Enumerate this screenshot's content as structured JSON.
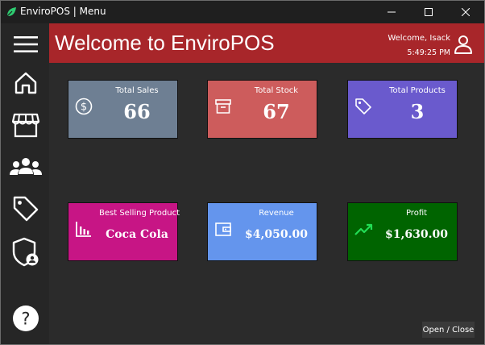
{
  "window": {
    "title": "EnviroPOS | Menu",
    "app_icon": "leaf-logo-icon",
    "controls": [
      "minimize-icon",
      "maximize-icon",
      "close-icon"
    ]
  },
  "sidebar": {
    "items": [
      {
        "name": "menu",
        "icon": "hamburger-icon"
      },
      {
        "name": "home",
        "icon": "home-icon"
      },
      {
        "name": "store",
        "icon": "store-icon"
      },
      {
        "name": "users",
        "icon": "users-group-icon"
      },
      {
        "name": "products",
        "icon": "tag-icon"
      },
      {
        "name": "admin",
        "icon": "shield-user-icon"
      },
      {
        "name": "help",
        "icon": "help-circle-icon",
        "label": "?"
      }
    ]
  },
  "header": {
    "title": "Welcome to EnviroPOS",
    "user_greeting": "Welcome, Isack",
    "time": "5:49:25 PM",
    "user_icon": "user-icon",
    "color": "#a8262a"
  },
  "cards": [
    {
      "label": "Total Sales",
      "value": "66",
      "icon": "dollar-circle-icon",
      "color": "#6e7f93"
    },
    {
      "label": "Total Stock",
      "value": "67",
      "icon": "archive-box-icon",
      "color": "#cd5c5c"
    },
    {
      "label": "Total Products",
      "value": "3",
      "icon": "tag-icon",
      "color": "#6a5acd"
    },
    {
      "label": "Best Selling Product",
      "value": "Coca Cola",
      "icon": "bar-chart-icon",
      "color": "#c71585"
    },
    {
      "label": "Revenue",
      "value": "$4,050.00",
      "icon": "wallet-icon",
      "color": "#6495ed"
    },
    {
      "label": "Profit",
      "value": "$1,630.00",
      "icon": "trending-up-icon",
      "color": "#006400",
      "icon_color": "#22dd55"
    }
  ],
  "footer": {
    "toggle_label": "Open / Close"
  }
}
